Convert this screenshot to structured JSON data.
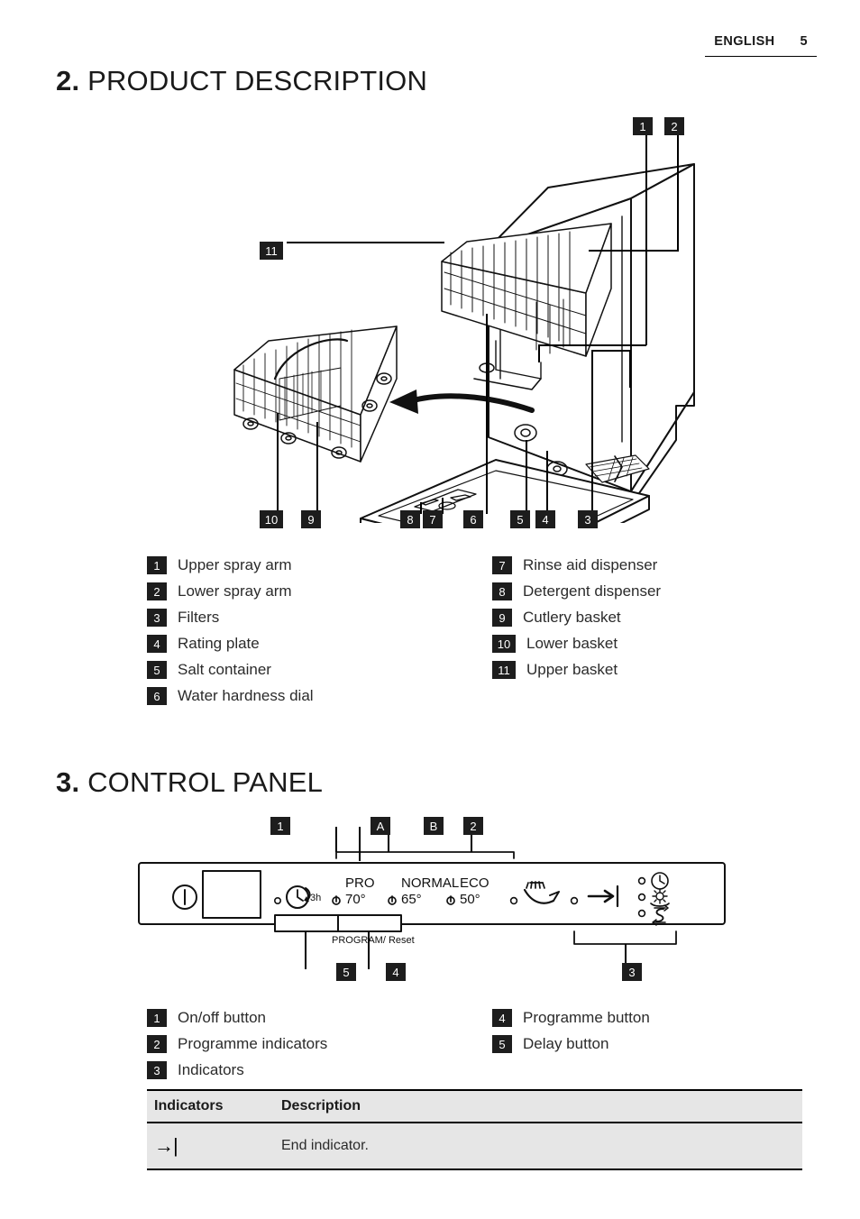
{
  "header": {
    "language": "ENGLISH",
    "page_number": "5"
  },
  "sections": [
    {
      "number": "2.",
      "title": "PRODUCT DESCRIPTION"
    },
    {
      "number": "3.",
      "title": "CONTROL PANEL"
    }
  ],
  "product_figure": {
    "callouts_top": [
      "1",
      "2"
    ],
    "callout_left": "11",
    "callouts_bottom": [
      "10",
      "9",
      "8",
      "7",
      "6",
      "5",
      "4",
      "3"
    ]
  },
  "product_legend": {
    "left": [
      {
        "num": "1",
        "label": "Upper spray arm"
      },
      {
        "num": "2",
        "label": "Lower spray arm"
      },
      {
        "num": "3",
        "label": "Filters"
      },
      {
        "num": "4",
        "label": "Rating plate"
      },
      {
        "num": "5",
        "label": "Salt container"
      },
      {
        "num": "6",
        "label": "Water hardness dial"
      }
    ],
    "right": [
      {
        "num": "7",
        "label": "Rinse aid dispenser"
      },
      {
        "num": "8",
        "label": "Detergent dispenser"
      },
      {
        "num": "9",
        "label": "Cutlery basket"
      },
      {
        "num": "10",
        "label": "Lower basket"
      },
      {
        "num": "11",
        "label": "Upper basket"
      }
    ]
  },
  "control_panel": {
    "callouts_top": [
      "1",
      "A",
      "B",
      "2"
    ],
    "callouts_bottom": [
      "5",
      "4",
      "3"
    ],
    "power_icon": "power-icon",
    "display_name": "display-window",
    "programmes": [
      {
        "name": "delay",
        "line1": "",
        "line2": "3h",
        "icon": "clock-arrow-icon"
      },
      {
        "name": "pro",
        "line1": "PRO",
        "line2": "70°",
        "icon": "power-small-icon"
      },
      {
        "name": "normal",
        "line1": "NORMAL",
        "line2": "65°",
        "icon": "power-small-icon"
      },
      {
        "name": "eco",
        "line1": "ECO",
        "line2": "50°",
        "icon": "power-small-icon"
      },
      {
        "name": "rinse",
        "line1": "",
        "line2": "",
        "icon": "spray-icon"
      },
      {
        "name": "end",
        "line1": "",
        "line2": "",
        "icon": "end-arrow-icon"
      }
    ],
    "program_reset_label": "PROGRAM/ Reset",
    "indicator_icons": [
      "clock-icon",
      "rinse-aid-icon",
      "salt-icon"
    ]
  },
  "panel_legend": {
    "left": [
      {
        "num": "1",
        "label": "On/off button"
      },
      {
        "num": "2",
        "label": "Programme indicators"
      },
      {
        "num": "3",
        "label": "Indicators"
      }
    ],
    "right": [
      {
        "num": "4",
        "label": "Programme button"
      },
      {
        "num": "5",
        "label": "Delay button"
      }
    ]
  },
  "indicators_table": {
    "headers": [
      "Indicators",
      "Description"
    ],
    "rows": [
      {
        "glyph": "→|",
        "description": "End indicator."
      }
    ]
  }
}
